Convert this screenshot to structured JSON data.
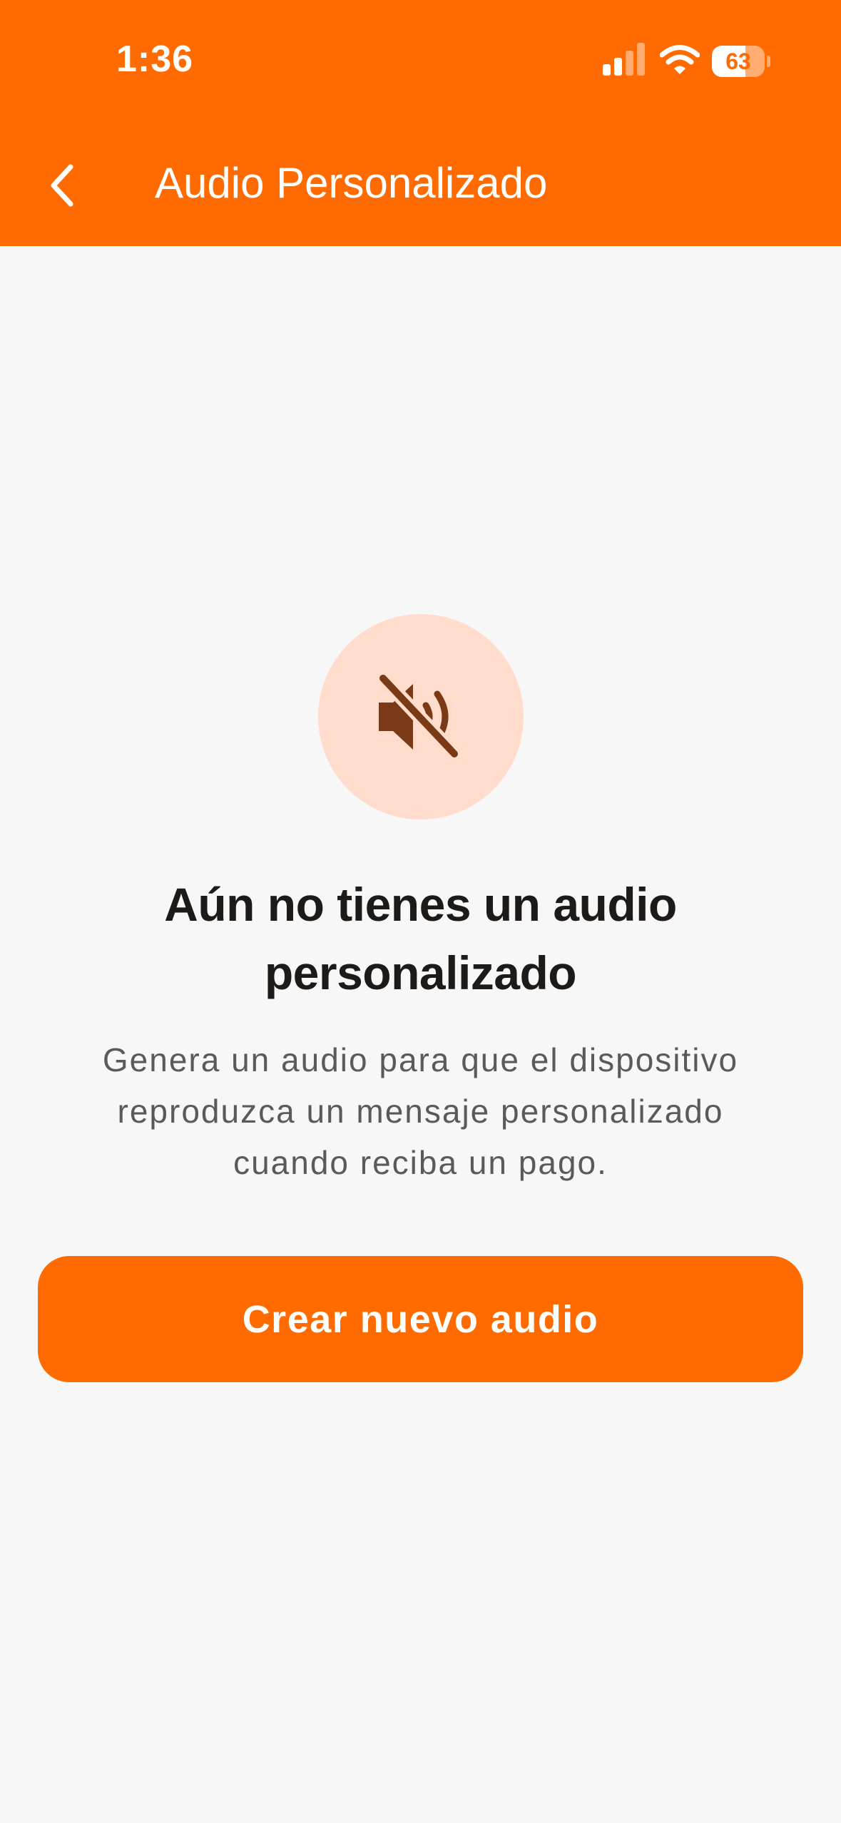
{
  "status_bar": {
    "time": "1:36",
    "battery_percent": "63",
    "battery_level": 0.63,
    "signal_bars_active": 2,
    "signal_bars_total": 4
  },
  "header": {
    "title": "Audio Personalizado",
    "back_icon": "chevron-left-icon",
    "background_color": "#ff6b00"
  },
  "empty_state": {
    "icon": "speaker-muted-icon",
    "icon_background_color": "#ffdccc",
    "icon_color": "#7a3a16",
    "title": "Aún no tienes un audio personalizado",
    "description": "Genera un audio para que el dispositivo reproduzca un mensaje personalizado cuando reciba un pago."
  },
  "actions": {
    "create_label": "Crear nuevo audio",
    "button_color": "#ff6b00"
  }
}
